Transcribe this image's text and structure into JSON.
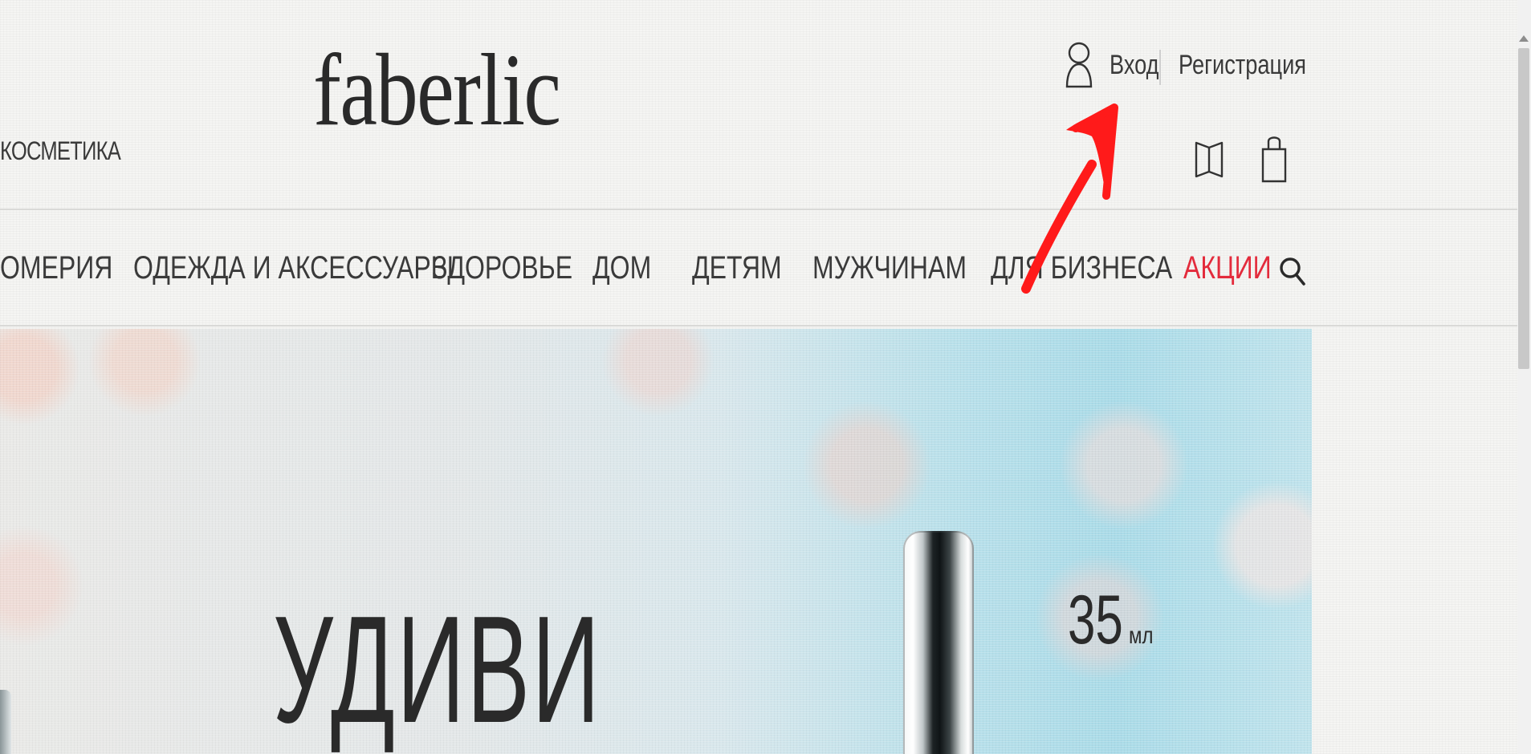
{
  "header": {
    "category_left": "КОСМЕТИКА",
    "logo": "faberlic",
    "login": "Вход",
    "register": "Регистрация",
    "icons": {
      "user": "user-icon",
      "catalog": "book-icon",
      "bag": "shopping-bag-icon",
      "search": "search-icon"
    }
  },
  "nav": {
    "items": [
      "ОМЕРИЯ",
      "ОДЕЖДА И АКСЕССУАРЫ",
      "ЗДОРОВЬЕ",
      "ДОМ",
      "ДЕТЯМ",
      "МУЖЧИНАМ",
      "ДЛЯ БИЗНЕСА",
      "АКЦИИ"
    ],
    "sale_color": "#e32b3c"
  },
  "banner": {
    "headline": "УДИВИ",
    "volume_number": "35",
    "volume_unit": "мл"
  },
  "annotation": {
    "color": "#ff1a1a"
  }
}
